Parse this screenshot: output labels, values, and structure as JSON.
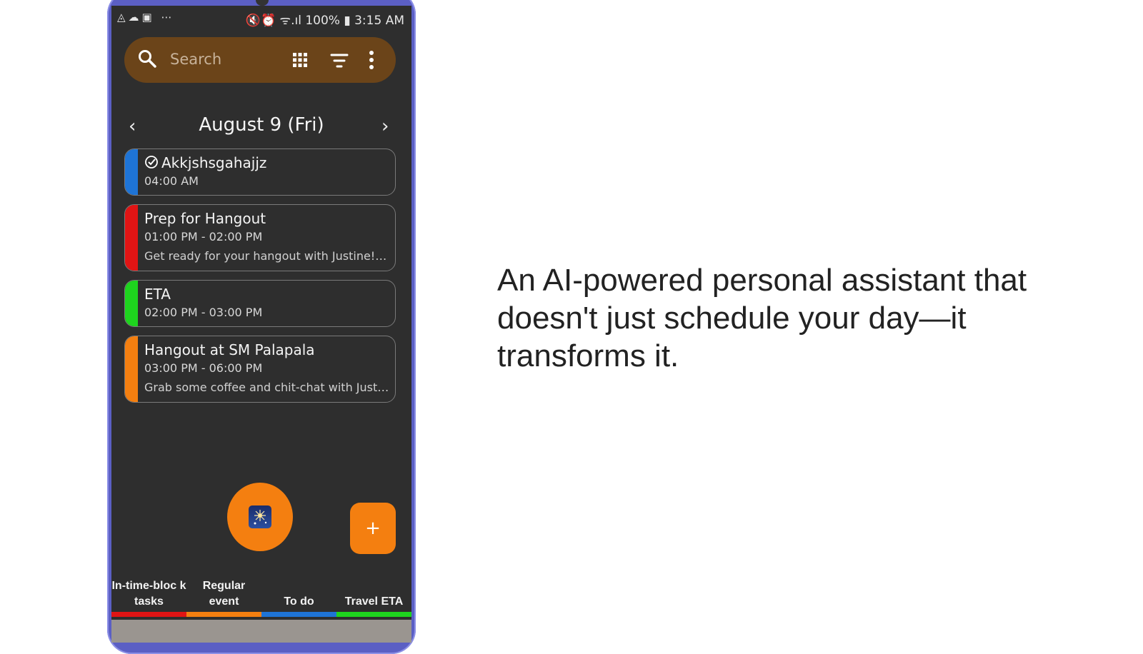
{
  "status_bar": {
    "left_icons": [
      "drive-icon",
      "cloud-icon",
      "image-icon",
      "more-dots-icon"
    ],
    "left_text": "◬☁▣ ⋯",
    "battery": "100%",
    "time": "3:15 AM",
    "right_icons_text": "🔇⏰ ᯤ.ıl"
  },
  "search": {
    "placeholder": "Search",
    "icons": [
      "search-icon",
      "grid-view-icon",
      "filter-icon",
      "more-vert-icon"
    ]
  },
  "date_nav": {
    "prev": "‹",
    "date": "August 9 (Fri)",
    "next": "›"
  },
  "events": [
    {
      "title": "Akkjshsgahajjz",
      "time": "04:00 AM",
      "desc": "",
      "color": "#1e74d6",
      "completed": true
    },
    {
      "title": "Prep for Hangout",
      "time": "01:00 PM - 02:00 PM",
      "desc": "Get ready for your hangout with Justine! Put t...",
      "color": "#e01414"
    },
    {
      "title": "ETA",
      "time": "02:00 PM - 03:00 PM",
      "desc": "",
      "color": "#1ed41e"
    },
    {
      "title": "Hangout at SM Palapala",
      "time": "03:00 PM - 06:00 PM",
      "desc": "Grab some coffee and chit-chat with Justine ...",
      "color": "#f47f10"
    }
  ],
  "fab": {
    "ai_icon": "sparkle-icon",
    "add_label": "+"
  },
  "legend": [
    {
      "label": "In-time-bloc k tasks",
      "color": "#e01414"
    },
    {
      "label": "Regular event",
      "color": "#f47f10"
    },
    {
      "label": "To do",
      "color": "#1e74d6"
    },
    {
      "label": "Travel ETA",
      "color": "#1ed41e"
    }
  ],
  "tagline": "An AI-powered personal assistant that doesn't just schedule your day—it transforms it."
}
